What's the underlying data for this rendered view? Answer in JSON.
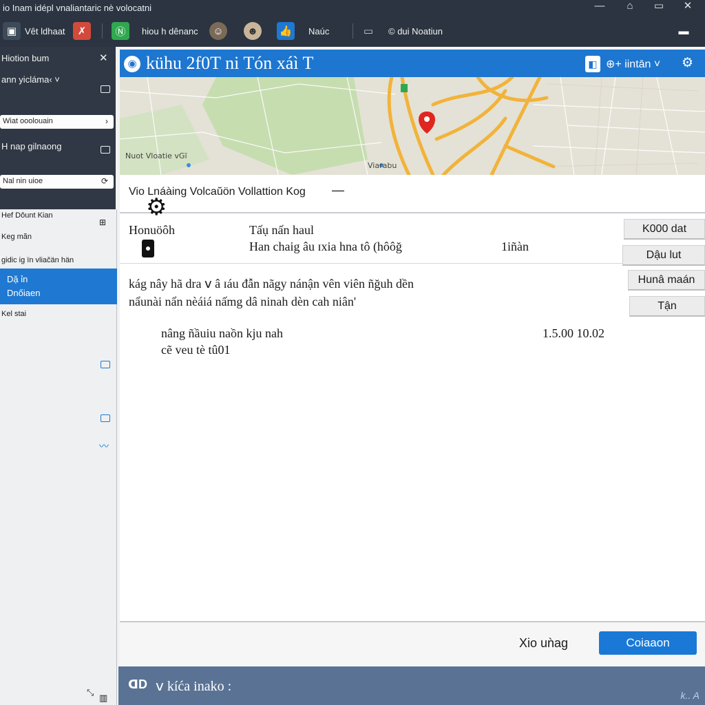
{
  "window": {
    "title": "io Inam idépl vnaliantaric nè volocatni",
    "controls": {
      "minimize": "—",
      "restore": "⌂",
      "maximize": "▭",
      "close": "✕"
    }
  },
  "toolbar": {
    "item1": {
      "icon": "window-icon",
      "label": "Vêt ldhaat"
    },
    "item2": {
      "icon": "red-x-icon",
      "color": "#d24a3b"
    },
    "item3": {
      "icon": "green-n-icon",
      "color": "#2fa84f"
    },
    "item4": {
      "label": "hiou h dênanc"
    },
    "item5": {
      "icon": "avatar-icon"
    },
    "item6": {
      "icon": "avatar-icon"
    },
    "item7": {
      "icon": "thumbs-up-icon",
      "color": "#1f78d1",
      "label": "Naúc"
    },
    "item8": {
      "icon": "briefcase-icon"
    },
    "item9": {
      "label": "© dui Noatiun"
    },
    "item10": {
      "icon": "minimize-icon"
    }
  },
  "sidebar": {
    "header": "Hiotion bum",
    "close": "✕",
    "item1": "ann yicláma‹ ˅",
    "pill1": "Wiat ooolouain",
    "item2": "H nap gilnaong",
    "pill2": "Nal nin uioe",
    "light_items": [
      "Hef Dôunt Kian",
      "Keg mãn",
      "gidic ig ïn vliačän hän"
    ],
    "selected": {
      "line1": "Dặ ỉn",
      "line2": "Dnốiaen"
    },
    "item_after": "Kel stai"
  },
  "main": {
    "title": "kühu 2f0T ni Tón xáì T",
    "header_right": "⊕+ iintān ˅",
    "map_labels": {
      "left": "Nuot Vloatie vGï",
      "bottom": "Viarabu"
    },
    "section_title": "Vio Lnáàing Volcaŭön Vollattion Kog",
    "field_label": "Honuöôh",
    "col2_label": "Tấụ nấn haul",
    "col2_value": "Han chaig âu ɪxia hna tô (hôôğ",
    "col3_value": "1iñàn",
    "buttons": [
      "K000 dat",
      "Dậu lut",
      "Hunâ maán",
      "Tận"
    ],
    "para_line1": "kág nây hã dra ⅴ â ɪáu đẫn nãgy nánận vên viên ñğuh dền",
    "para_line2": "nẩunài nẩn nèáiá nấmg dâ ninah dèn cah niân'",
    "item_name1": "nâng ñầuiu naồn kju nah",
    "item_name2": "cẽ veu tè tû01",
    "item_value": "1.5.00 10.02",
    "cancel": "Xio uǹag",
    "primary": "Coiaaon"
  },
  "statusbar": {
    "icon": "ᗡD",
    "text": "ⅴ kíća inako :",
    "corner": "k.. A"
  },
  "colors": {
    "accent": "#1d76d0",
    "dark": "#2f3844",
    "status": "#5a7394"
  }
}
